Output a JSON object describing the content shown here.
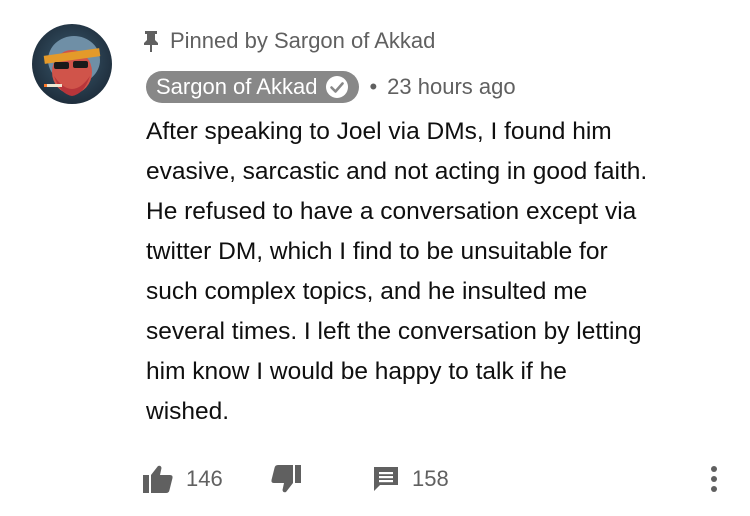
{
  "pinned": {
    "text": "Pinned by Sargon of Akkad"
  },
  "author": {
    "name": "Sargon of Akkad",
    "verified": true,
    "separator": "•",
    "timestamp": "23 hours ago"
  },
  "comment": {
    "text": "After speaking to Joel via DMs, I found him\nevasive, sarcastic and not acting in good faith.\nHe refused to have a conversation except via\ntwitter DM, which I find to be unsuitable for\nsuch complex topics, and he insulted me\nseveral times. I left the conversation by letting\nhim know I would be happy to talk if he\nwished."
  },
  "actions": {
    "likes": "146",
    "replies": "158"
  },
  "icons": {
    "pin": "pin-icon",
    "verified": "checkmark-icon",
    "like": "thumbs-up-icon",
    "dislike": "thumbs-down-icon",
    "reply": "comment-icon",
    "more": "more-vertical-icon"
  },
  "colors": {
    "chip_background": "#888888",
    "secondary_text": "#606060",
    "primary_text": "#0f0f0f"
  }
}
